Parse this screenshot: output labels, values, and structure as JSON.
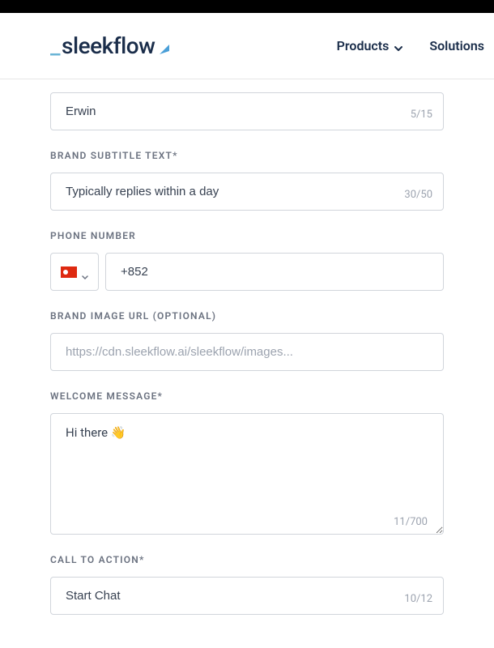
{
  "logo": {
    "prefix": "_",
    "text": "sleekflow"
  },
  "nav": {
    "products": "Products",
    "solutions": "Solutions"
  },
  "form": {
    "brand_name": {
      "value": "Erwin",
      "counter": "5/15"
    },
    "brand_subtitle": {
      "label": "BRAND SUBTITLE TEXT*",
      "value": "Typically replies within a day",
      "counter": "30/50"
    },
    "phone": {
      "label": "PHONE NUMBER",
      "country_code": "+852"
    },
    "brand_image": {
      "label": "BRAND IMAGE URL (OPTIONAL)",
      "placeholder": "https://cdn.sleekflow.ai/sleekflow/images..."
    },
    "welcome_message": {
      "label": "WELCOME MESSAGE*",
      "value": "Hi there 👋",
      "counter": "11/700"
    },
    "cta": {
      "label": "CALL TO ACTION*",
      "value": "Start Chat",
      "counter": "10/12"
    }
  }
}
